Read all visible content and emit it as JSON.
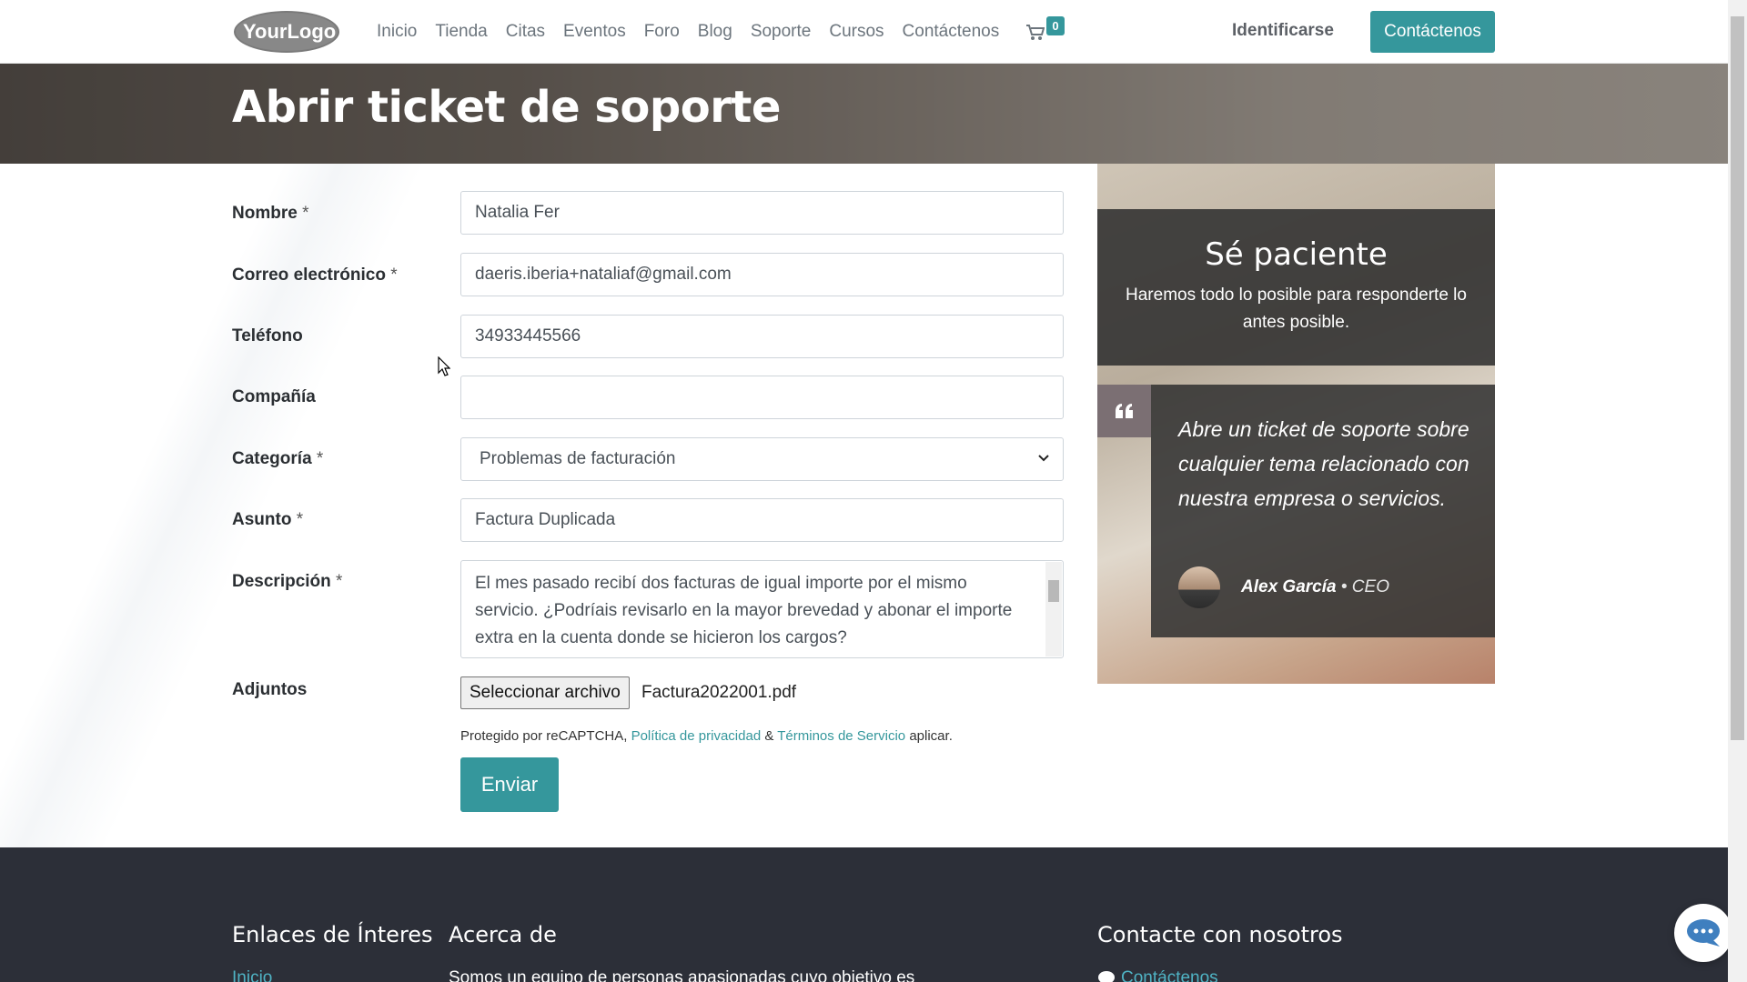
{
  "header": {
    "logo_text": "YourLogo",
    "nav": [
      "Inicio",
      "Tienda",
      "Citas",
      "Eventos",
      "Foro",
      "Blog",
      "Soporte",
      "Cursos",
      "Contáctenos"
    ],
    "cart_count": "0",
    "login": "Identificarse",
    "cta": "Contáctenos"
  },
  "hero": {
    "title": "Abrir ticket de soporte"
  },
  "form": {
    "name": {
      "label": "Nombre",
      "value": "Natalia Fer"
    },
    "email": {
      "label": "Correo electrónico",
      "value": "daeris.iberia+nataliaf@gmail.com"
    },
    "phone": {
      "label": "Teléfono",
      "value": "34933445566"
    },
    "company": {
      "label": "Compañía",
      "value": ""
    },
    "category": {
      "label": "Categoría",
      "value": "Problemas de facturación"
    },
    "subject": {
      "label": "Asunto",
      "value": "Factura Duplicada"
    },
    "description": {
      "label": "Descripción",
      "value": "El mes pasado recibí dos facturas de igual importe por el mismo servicio. ¿Podríais revisarlo en la mayor brevedad y abonar el importe extra en la cuenta donde se hicieron los cargos?"
    },
    "attachments": {
      "label": "Adjuntos",
      "button": "Seleccionar archivo",
      "file": "Factura2022001.pdf"
    },
    "required_mark": "*",
    "recaptcha": {
      "prefix": "Protegido por reCAPTCHA,",
      "privacy": "Política de privacidad",
      "amp": "&",
      "terms": "Términos de Servicio",
      "suffix": "aplicar."
    },
    "submit": "Enviar"
  },
  "panel": {
    "title": "Sé paciente",
    "subtitle": "Haremos todo lo posible para responderte lo antes posible.",
    "quote": "Abre un ticket de soporte sobre cualquier tema relacionado con nuestra empresa o servicios.",
    "author": "Alex García",
    "sep": "•",
    "role": "CEO"
  },
  "footer": {
    "col1_title": "Enlaces de Ínteres",
    "col1_link": "Inicio",
    "col2_title": "Acerca de",
    "col2_text": "Somos un equipo de personas apasionadas cuyo objetivo es",
    "col3_title": "Contacte con nosotros",
    "col3_link": "Contáctenos"
  },
  "colors": {
    "accent": "#35979c",
    "footer_bg": "#2c2f38"
  },
  "icons": [
    "cart-icon",
    "quote-icon",
    "chevron-down-icon",
    "chat-icon",
    "comment-icon"
  ]
}
